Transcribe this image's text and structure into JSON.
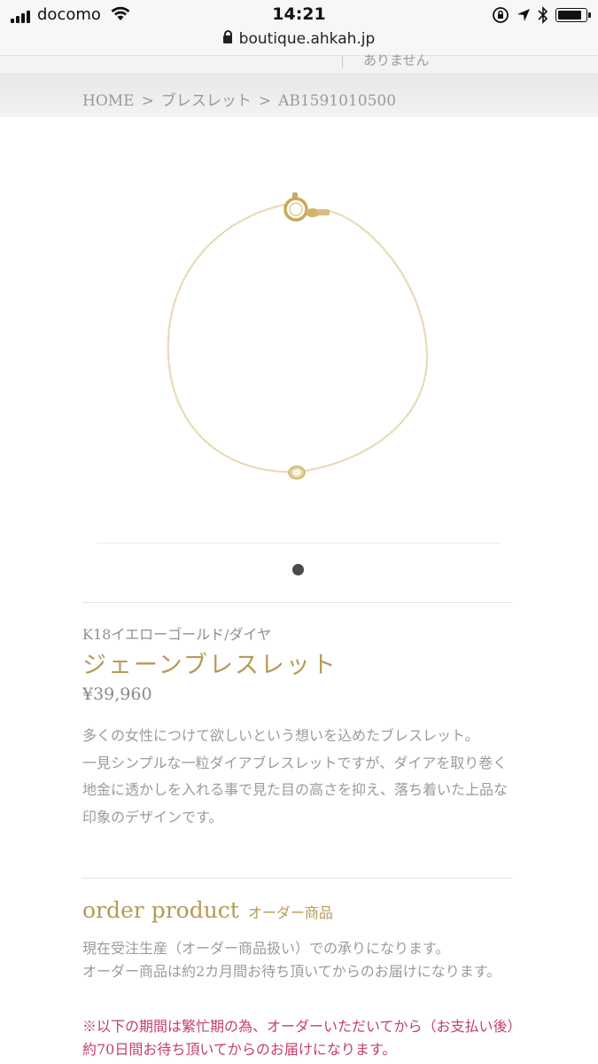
{
  "status_bar": {
    "carrier": "docomo",
    "time": "14:21",
    "icons": [
      "signal-icon",
      "wifi-icon",
      "rotation-lock-icon",
      "location-arrow-icon",
      "bluetooth-icon",
      "battery-icon"
    ]
  },
  "browser": {
    "url": "boutique.ahkah.jp"
  },
  "subheader": {
    "partial_text": "ありません"
  },
  "breadcrumb": {
    "items": [
      "HOME",
      "ブレスレット",
      "AB1591010500"
    ],
    "separator": ">"
  },
  "product": {
    "material": "K18イエローゴールド/ダイヤ",
    "name": "ジェーンブレスレット",
    "price": "¥39,960",
    "description": [
      "多くの女性につけて欲しいという想いを込めたブレスレット。",
      "一見シンプルな一粒ダイアブレスレットですが、ダイアを取り巻く地金に透かしを入れる事で見た目の高さを抑え、落ち着いた上品な印象のデザインです。"
    ],
    "image_alt_icon": "bracelet-image"
  },
  "order": {
    "title": "order product",
    "title_jp": "オーダー商品",
    "text": [
      "現在受注生産（オーダー商品扱い）での承りになります。",
      "オーダー商品は約2カ月間お待ち頂いてからのお届けになります。"
    ],
    "notice": "※以下の期間は繁忙期の為、オーダーいただいてから（お支払い後）約70日間お待ち頂いてからのお届けになります。"
  },
  "colors": {
    "accent_gold": "#b79a55",
    "notice_red": "#c4406a",
    "text_gray": "#9b9b9b"
  }
}
